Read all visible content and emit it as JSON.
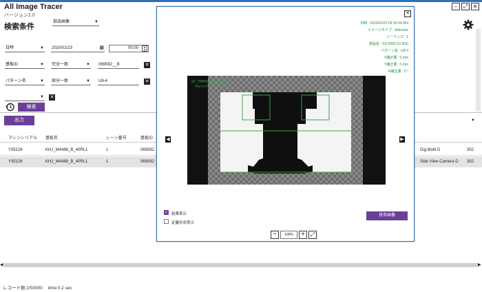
{
  "app": {
    "title": "All Image Tracer",
    "version": "バージョン2.0"
  },
  "window_buttons": {
    "minimize": "–",
    "maximize": "⤢",
    "close": "✕"
  },
  "search": {
    "section_title": "検索条件",
    "category_select": "部品画像",
    "date": {
      "label": "日時",
      "value": "2020/01/23",
      "time": "00:00"
    },
    "board_id": {
      "label": "基板ID",
      "match": "完全一致",
      "value": "069082__B"
    },
    "pattern_name": {
      "label": "パターン名",
      "match": "部分一致",
      "value": "U8-4"
    },
    "search_button": "検索"
  },
  "output_button": "出力",
  "table": {
    "headers": [
      "マシンシリアル",
      "基板名",
      "レーン番号",
      "基板ID"
    ],
    "rows": [
      {
        "serial": "Y35126",
        "board": "KHJ_M4488_B_40RL1",
        "lane": "1",
        "id": "069082",
        "camera": "Dig.Multi D",
        "num": "302"
      },
      {
        "serial": "Y35126",
        "board": "KHJ_M4488_B_40RL1",
        "lane": "1",
        "id": "069082",
        "camera": "Side View Camera D",
        "num": "302"
      }
    ]
  },
  "status": {
    "records": "レコード数:2/50000",
    "time": "time:0.2 sec"
  },
  "viewer": {
    "info_lines": [
      "日時 : 2020/01/23 09:16:54.064",
      "イメージタイプ : Sideview",
      "シーケンス : 1",
      "部品名 : SS-0050-S1-B10",
      "パターン名 : U8-4",
      "X補正量 : 0 mm",
      "Y補正量 : 0 mm",
      "R補正量 : 0 °"
    ],
    "overlay_line1": "SV_TR0000000000000",
    "overlay_line2": "PartsTop",
    "show_result": {
      "label": "結果表示",
      "checked": true
    },
    "show_shape": {
      "label": "定義形状表示",
      "checked": false
    },
    "compare_button": "良否画像",
    "zoom_value": "100%",
    "prev": "◀",
    "next": "▶",
    "close": "✕"
  }
}
